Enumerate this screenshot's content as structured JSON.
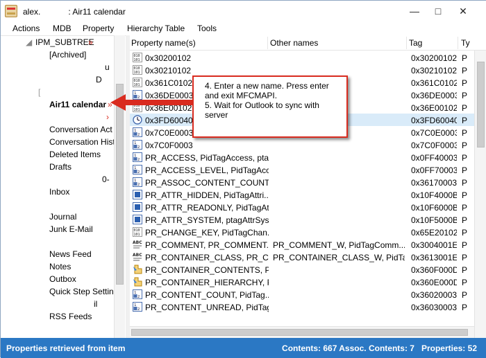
{
  "window": {
    "title": "alex.            : Air11 calendar",
    "minimize": "—",
    "maximize": "□",
    "close": "✕"
  },
  "menu": [
    "Actions",
    "MDB",
    "Property",
    "Hierarchy Table",
    "Tools"
  ],
  "tree": [
    {
      "label": "IPM_SUBTREE",
      "marker": "»"
    },
    {
      "label": "[Archived]"
    },
    {
      "label": "u"
    },
    {
      "label": "D"
    },
    {
      "label": "["
    },
    {
      "label": "Air11 calendar",
      "marker": "»",
      "bold": true
    },
    {
      "label": "›"
    },
    {
      "label": "Conversation Act"
    },
    {
      "label": "Conversation Hist"
    },
    {
      "label": "Deleted Items"
    },
    {
      "label": "Drafts"
    },
    {
      "label": "0-"
    },
    {
      "label": "Inbox"
    },
    {
      "label": "Journal"
    },
    {
      "label": "Junk E-Mail"
    },
    {
      "label": "News Feed"
    },
    {
      "label": "Notes"
    },
    {
      "label": "Outbox"
    },
    {
      "label": "Quick Step Setting"
    },
    {
      "label": "il"
    },
    {
      "label": "RSS Feeds"
    }
  ],
  "list": {
    "columns": [
      "Property name(s)",
      "Other names",
      "Tag",
      "Ty"
    ],
    "rows": [
      {
        "icon": "binary",
        "name": "0x30200102",
        "other": "",
        "tag": "0x30200102",
        "type": "P"
      },
      {
        "icon": "binary",
        "name": "0x30210102",
        "other": "",
        "tag": "0x30210102",
        "type": "P"
      },
      {
        "icon": "binary",
        "name": "0x361C0102",
        "other": "",
        "tag": "0x361C0102",
        "type": "P"
      },
      {
        "icon": "number",
        "name": "0x36DE0003",
        "other": "",
        "tag": "0x36DE0003",
        "type": "P"
      },
      {
        "icon": "binary",
        "name": "0x36E00102",
        "other": "",
        "tag": "0x36E00102",
        "type": "P"
      },
      {
        "icon": "clock",
        "name": "0x3FD60040",
        "other": "",
        "tag": "0x3FD60040",
        "type": "P",
        "selected": true
      },
      {
        "icon": "number",
        "name": "0x7C0E0003",
        "other": "",
        "tag": "0x7C0E0003",
        "type": "P"
      },
      {
        "icon": "number",
        "name": "0x7C0F0003",
        "other": "",
        "tag": "0x7C0F0003",
        "type": "P"
      },
      {
        "icon": "number",
        "name": "PR_ACCESS, PidTagAccess, pta...",
        "other": "",
        "tag": "0x0FF40003",
        "type": "P"
      },
      {
        "icon": "number",
        "name": "PR_ACCESS_LEVEL, PidTagAcce...",
        "other": "",
        "tag": "0x0FF70003",
        "type": "P"
      },
      {
        "icon": "number",
        "name": "PR_ASSOC_CONTENT_COUNT,...",
        "other": "",
        "tag": "0x36170003",
        "type": "P"
      },
      {
        "icon": "bool",
        "name": "PR_ATTR_HIDDEN, PidTagAttri...",
        "other": "",
        "tag": "0x10F4000B",
        "type": "P"
      },
      {
        "icon": "bool",
        "name": "PR_ATTR_READONLY, PidTagAtt...",
        "other": "",
        "tag": "0x10F6000B",
        "type": "P"
      },
      {
        "icon": "bool",
        "name": "PR_ATTR_SYSTEM, ptagAttrSyst...",
        "other": "",
        "tag": "0x10F5000B",
        "type": "P"
      },
      {
        "icon": "binary",
        "name": "PR_CHANGE_KEY, PidTagChan...",
        "other": "",
        "tag": "0x65E20102",
        "type": "P"
      },
      {
        "icon": "string",
        "name": "PR_COMMENT, PR_COMMENT...",
        "other": "PR_COMMENT_W, PidTagComm...",
        "tag": "0x3004001E",
        "type": "P"
      },
      {
        "icon": "string",
        "name": "PR_CONTAINER_CLASS, PR_CO...",
        "other": "PR_CONTAINER_CLASS_W, PidTa...",
        "tag": "0x3613001E",
        "type": "P"
      },
      {
        "icon": "object",
        "name": "PR_CONTAINER_CONTENTS, Pi...",
        "other": "",
        "tag": "0x360F000D",
        "type": "P"
      },
      {
        "icon": "object",
        "name": "PR_CONTAINER_HIERARCHY, P...",
        "other": "",
        "tag": "0x360E000D",
        "type": "P"
      },
      {
        "icon": "number",
        "name": "PR_CONTENT_COUNT, PidTag...",
        "other": "",
        "tag": "0x36020003",
        "type": "P"
      },
      {
        "icon": "number",
        "name": "PR_CONTENT_UNREAD, PidTag...",
        "other": "",
        "tag": "0x36030003",
        "type": "P"
      }
    ]
  },
  "callout": {
    "step4": "4. Enter a new name. Press enter and exit MFCMAPI.",
    "step5": "5. Wait for Outlook to sync with server"
  },
  "status": {
    "left": "Properties retrieved from item",
    "right": "Contents: 667 Assoc. Contents: 7   Properties: 52"
  },
  "colors": {
    "status_bar": "#2b78c4",
    "callout_border": "#d92b1f",
    "selection": "#d9ebf9"
  }
}
